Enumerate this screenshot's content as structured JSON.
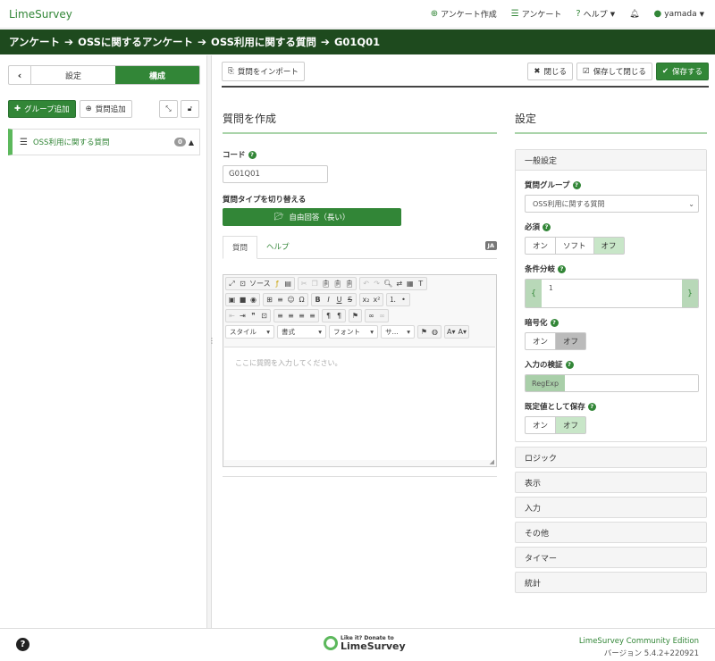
{
  "topnav": {
    "brand": "LimeSurvey",
    "create_survey": "アンケート作成",
    "surveys": "アンケート",
    "help": "ヘルプ",
    "user": "yamada"
  },
  "breadcrumb": [
    "アンケート",
    "OSSに関するアンケート",
    "OSS利用に関する質問",
    "G01Q01"
  ],
  "sidebar": {
    "tab_settings": "設定",
    "tab_structure": "構成",
    "add_group": "グループ追加",
    "add_question": "質問追加",
    "group_name": "OSS利用に関する質問",
    "group_count": "0"
  },
  "toolbar": {
    "import": "質問をインポート",
    "close": "閉じる",
    "save_close": "保存して閉じる",
    "save": "保存する"
  },
  "create": {
    "title": "質問を作成",
    "code_label": "コード",
    "code_value": "G01Q01",
    "type_label": "質問タイプを切り替える",
    "type_value": "自由回答（長い）",
    "tab_question": "質問",
    "tab_help": "ヘルプ",
    "lang": "JA"
  },
  "editor": {
    "source": "ソース",
    "style": "スタイル",
    "format": "書式",
    "font": "フォント",
    "size": "サ...",
    "placeholder": "ここに質問を入力してください。"
  },
  "settings": {
    "title": "設定",
    "general": "一般設定",
    "group_label": "質問グループ",
    "group_value": "OSS利用に関する質問",
    "mandatory_label": "必須",
    "mandatory_options": [
      "オン",
      "ソフト",
      "オフ"
    ],
    "condition_label": "条件分岐",
    "condition_value": "1",
    "encrypt_label": "暗号化",
    "encrypt_options": [
      "オン",
      "オフ"
    ],
    "validation_label": "入力の検証",
    "regex": "RegExp",
    "save_default_label": "既定値として保存",
    "save_default_options": [
      "オン",
      "オフ"
    ],
    "sections": [
      "ロジック",
      "表示",
      "入力",
      "その他",
      "タイマー",
      "統計"
    ]
  },
  "footer": {
    "donate_top": "Like it? Donate to",
    "donate_brand": "LimeSurvey",
    "edition": "LimeSurvey Community Edition",
    "version": "バージョン 5.4.2+220921"
  },
  "colors": {
    "accent": "#328637",
    "breadcrumb_bg": "#1e4a1e"
  }
}
